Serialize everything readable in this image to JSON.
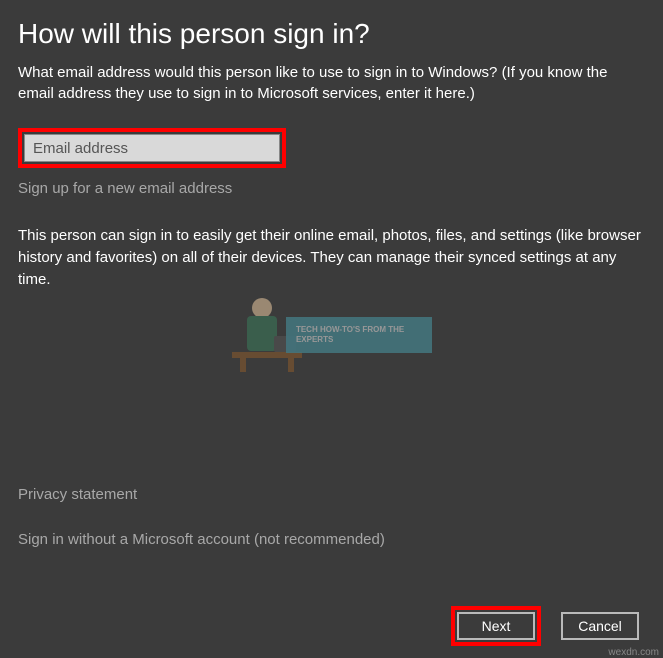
{
  "title": "How will this person sign in?",
  "subtitle": "What email address would this person like to use to sign in to Windows? (If you know the email address they use to sign in to Microsoft services, enter it here.)",
  "email_placeholder": "Email address",
  "signup_link": "Sign up for a new email address",
  "description": "This person can sign in to easily get their online email, photos, files, and settings (like browser history and favorites) on all of their devices. They can manage their synced settings at any time.",
  "privacy_link": "Privacy statement",
  "signin_local": "Sign in without a Microsoft account (not recommended)",
  "buttons": {
    "next": "Next",
    "cancel": "Cancel"
  },
  "watermark_text": "TECH HOW-TO'S FROM THE EXPERTS",
  "source": "wexdn.com"
}
